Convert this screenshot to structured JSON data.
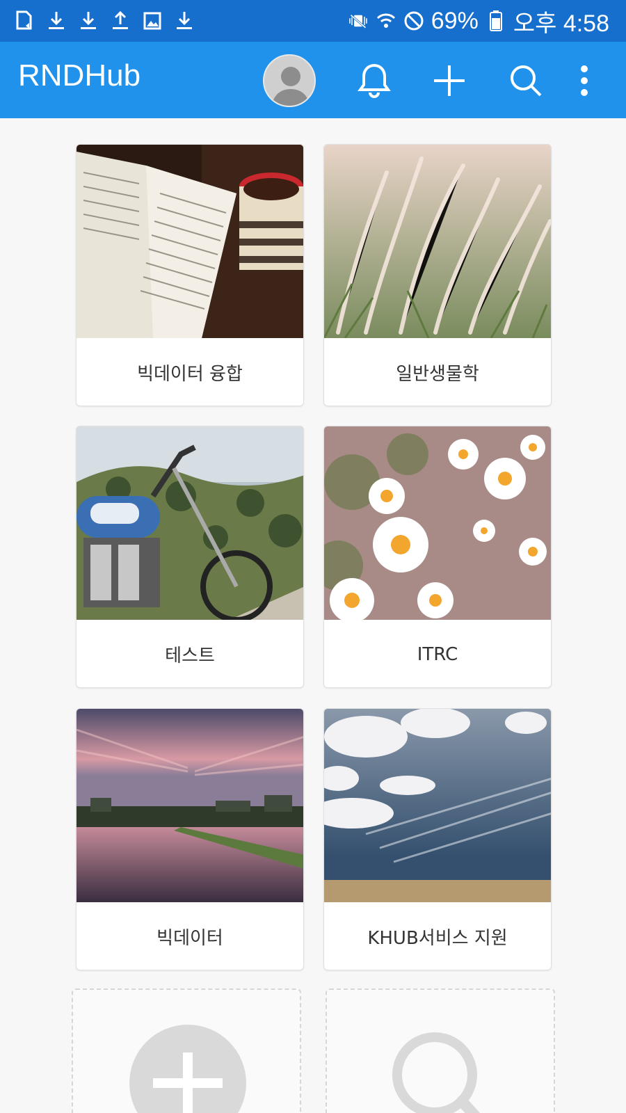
{
  "status_bar": {
    "left_icons": [
      "sim-card-icon",
      "download-icon",
      "download-icon",
      "upload-icon",
      "image-icon",
      "download-icon"
    ],
    "right_icons": [
      "vibrate-mute-icon",
      "wifi-icon",
      "do-not-disturb-icon",
      "battery-icon"
    ],
    "battery": "69%",
    "time": "오후 4:58"
  },
  "app_bar": {
    "title": "RNDHub",
    "icons": [
      "avatar",
      "bell-icon",
      "plus-icon",
      "search-icon",
      "more-vertical-icon"
    ]
  },
  "cards": [
    {
      "label": "빅데이터 융합",
      "image": "book-and-cup-photo"
    },
    {
      "label": "일반생물학",
      "image": "pampas-grass-photo"
    },
    {
      "label": "테스트",
      "image": "motorcycle-photo"
    },
    {
      "label": "ITRC",
      "image": "daisies-photo"
    },
    {
      "label": "빅데이터",
      "image": "river-sunset-photo"
    },
    {
      "label": "KHUB서비스 지원",
      "image": "cloudy-sky-photo"
    }
  ],
  "bottom_actions": [
    "add-hub-icon",
    "search-hub-icon"
  ],
  "colors": {
    "status_bar": "#176fcd",
    "app_bar": "#2192ec",
    "background": "#f7f7f7",
    "placeholder_icon": "#d9d9d9"
  }
}
